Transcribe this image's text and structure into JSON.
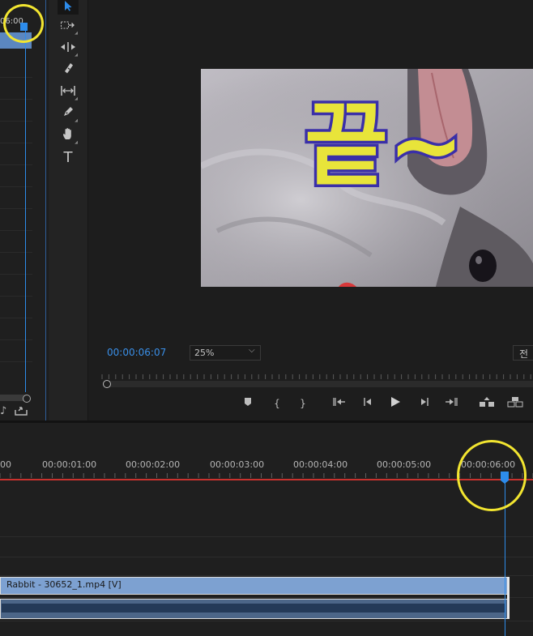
{
  "source_panel": {
    "timecode": "06:00"
  },
  "tools": [
    {
      "name": "selection-tool"
    },
    {
      "name": "track-select-tool"
    },
    {
      "name": "ripple-edit-tool"
    },
    {
      "name": "razor-tool"
    },
    {
      "name": "slip-tool"
    },
    {
      "name": "pen-tool"
    },
    {
      "name": "hand-tool"
    },
    {
      "name": "type-tool",
      "label": "T"
    }
  ],
  "program_monitor": {
    "caption": "끝~",
    "timecode": "00:00:06:07",
    "zoom": "25%",
    "resolution": "전",
    "transport": [
      "marker-button",
      "mark-in-button",
      "mark-out-button",
      "go-to-in-button",
      "step-back-button",
      "play-button",
      "step-forward-button",
      "go-to-out-button",
      "lift-button",
      "extract-button"
    ]
  },
  "timeline": {
    "time_labels": [
      "00",
      "00:00:01:00",
      "00:00:02:00",
      "00:00:03:00",
      "00:00:04:00",
      "00:00:05:00",
      "00:00:06:00"
    ],
    "video_clip": "Rabbit - 30652_1.mp4 [V]"
  },
  "colors": {
    "accent": "#2d8ceb",
    "highlight_circle": "#f2e530",
    "work_area": "#c9322e",
    "video_clip": "#7da1d1",
    "caption_fill": "#e8e43a",
    "caption_outline": "#3a2fa8"
  }
}
